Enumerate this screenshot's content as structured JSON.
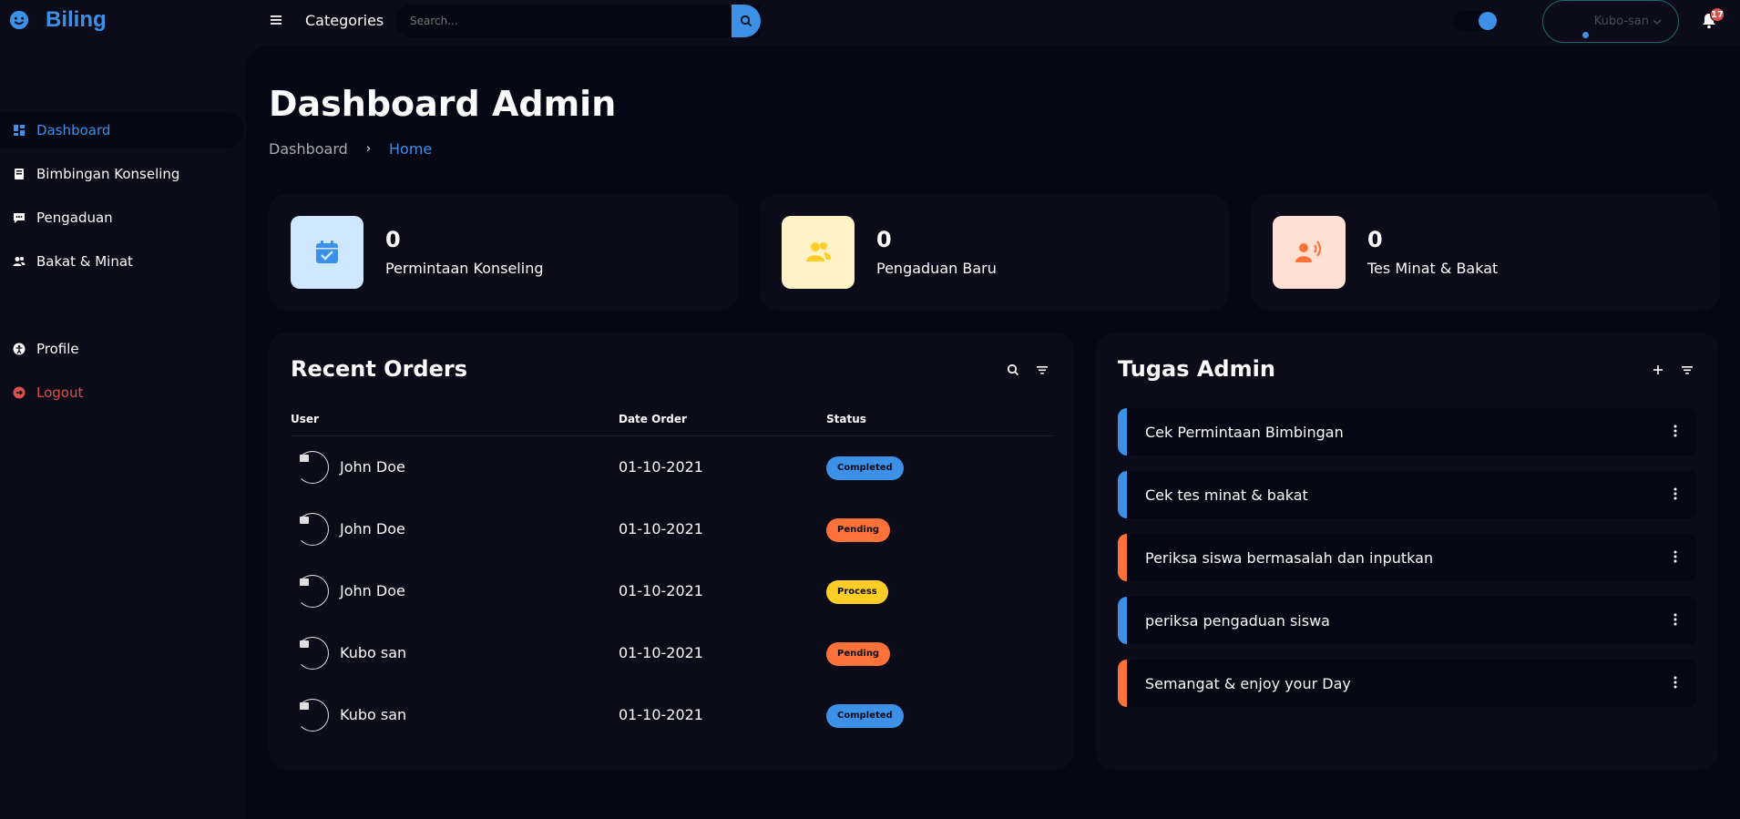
{
  "app": {
    "brand": "Biling"
  },
  "topnav": {
    "categories_label": "Categories",
    "search_placeholder": "Search...",
    "user_name": "Kubo-san",
    "notification_count": "17"
  },
  "sidebar": {
    "items": [
      {
        "label": "Dashboard",
        "icon": "dashboard-icon",
        "active": true
      },
      {
        "label": "Bimbingan Konseling",
        "icon": "book-icon",
        "active": false
      },
      {
        "label": "Pengaduan",
        "icon": "chat-icon",
        "active": false
      },
      {
        "label": "Bakat & Minat",
        "icon": "users-icon",
        "active": false
      },
      {
        "label": "Profile",
        "icon": "profile-icon",
        "active": false
      },
      {
        "label": "Logout",
        "icon": "logout-icon",
        "active": false
      }
    ]
  },
  "main": {
    "title": "Dashboard Admin",
    "breadcrumb": [
      "Dashboard",
      "Home"
    ],
    "stats": [
      {
        "value": "0",
        "label": "Permintaan Konseling",
        "icon": "calendar-check-icon",
        "bg": "#cfe8ff",
        "color": "#3c91e6"
      },
      {
        "value": "0",
        "label": "Pengaduan Baru",
        "icon": "group-icon",
        "bg": "#fff2c6",
        "color": "#ffce26"
      },
      {
        "value": "0",
        "label": "Tes Minat & Bakat",
        "icon": "speaker-icon",
        "bg": "#ffe0d3",
        "color": "#fd7238"
      }
    ]
  },
  "orders": {
    "title": "Recent Orders",
    "columns": [
      "User",
      "Date Order",
      "Status"
    ],
    "rows": [
      {
        "user": "John Doe",
        "date": "01-10-2021",
        "status": "Completed"
      },
      {
        "user": "John Doe",
        "date": "01-10-2021",
        "status": "Pending"
      },
      {
        "user": "John Doe",
        "date": "01-10-2021",
        "status": "Process"
      },
      {
        "user": "Kubo san",
        "date": "01-10-2021",
        "status": "Pending"
      },
      {
        "user": "Kubo san",
        "date": "01-10-2021",
        "status": "Completed"
      }
    ],
    "status_colors": {
      "Completed": "#3c91e6",
      "Pending": "#fd7238",
      "Process": "#ffce26"
    }
  },
  "todo": {
    "title": "Tugas Admin",
    "items": [
      {
        "text": "Cek Permintaan Bimbingan",
        "state": "completed"
      },
      {
        "text": "Cek tes minat & bakat",
        "state": "completed"
      },
      {
        "text": "Periksa siswa bermasalah dan inputkan",
        "state": "not-completed"
      },
      {
        "text": "periksa pengaduan siswa",
        "state": "completed"
      },
      {
        "text": "Semangat & enjoy your Day",
        "state": "not-completed"
      }
    ]
  },
  "colors": {
    "accent": "#3c91e6",
    "orange": "#fd7238",
    "yellow": "#ffce26",
    "danger": "#db504a"
  }
}
